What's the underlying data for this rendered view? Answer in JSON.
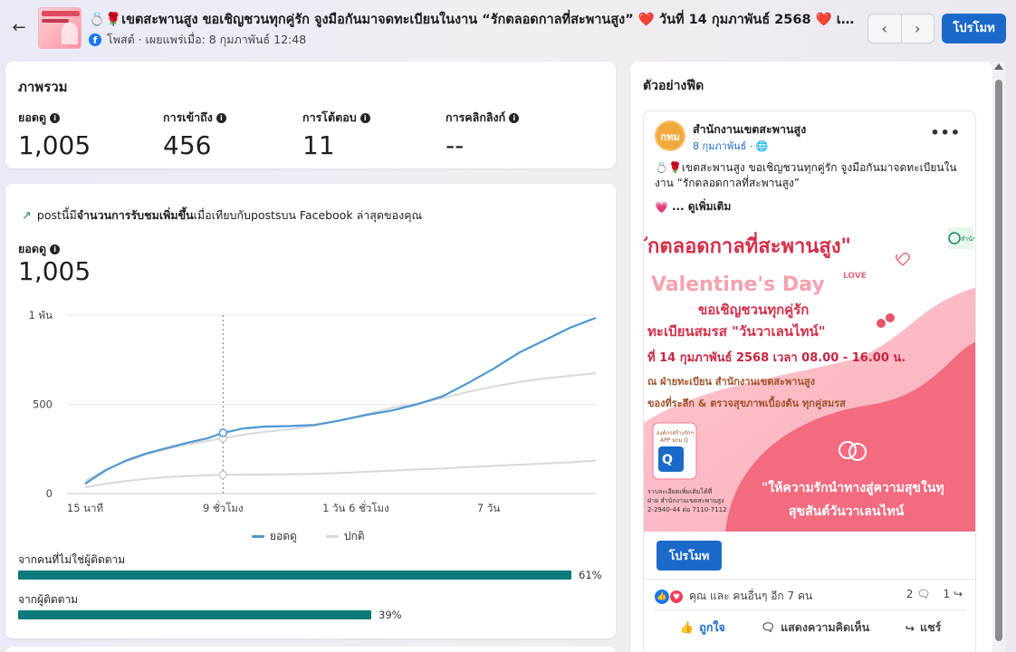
{
  "header": {
    "post_title": "💍🌹เขตสะพานสูง ขอเชิญชวนทุกคู่รัก จูงมือกันมาจดทะเบียนในงาน “รักตลอดกาลที่สะพานสูง” ❤️ วันที่ 14 กุมภาพันธ์ 2568 ❤️ เว...",
    "meta": "โพสต์ · เผยแพร่เมื่อ: 8 กุมภาพันธ์ 12:48",
    "promote_label": "โปรโมท",
    "prev_label": "‹",
    "next_label": "›"
  },
  "overview": {
    "title": "ภาพรวม",
    "metrics": [
      {
        "label": "ยอดดู",
        "value": "1,005"
      },
      {
        "label": "การเข้าถึง",
        "value": "456"
      },
      {
        "label": "การโต้ตอบ",
        "value": "11"
      },
      {
        "label": "การคลิกลิงก์",
        "value": "--"
      }
    ]
  },
  "views": {
    "trend_prefix": "postนี้มี",
    "trend_bold": "จำนวนการรับชมเพิ่มขึ้น",
    "trend_suffix": "เมื่อเทียบกับpostsบน Facebook ล่าสุดของคุณ",
    "label": "ยอดดู",
    "value": "1,005",
    "legend": [
      {
        "name": "ยอดดู",
        "color": "#4d97d1"
      },
      {
        "name": "ปกติ",
        "color": "#d6d8dc"
      }
    ],
    "breakdown": [
      {
        "label": "จากคนที่ไม่ใช่ผู้ติดตาม",
        "percent": 61,
        "percent_label": "61%"
      },
      {
        "label": "จากผู้ติดตาม",
        "percent": 39,
        "percent_label": "39%"
      }
    ]
  },
  "chart_data": {
    "type": "line",
    "y_ticks": [
      "0",
      "500",
      "1 พัน"
    ],
    "ylim": [
      0,
      1000
    ],
    "x_ticks": [
      "15 นาที",
      "9 ชั่วโมง",
      "1 วัน 6 ชั่วโมง",
      "7 วัน"
    ],
    "x_tick_positions": [
      0.0,
      0.27,
      0.53,
      0.79
    ],
    "hover_x": 0.27,
    "series": [
      {
        "name": "ยอดดู",
        "color": "#4d97d1",
        "x": [
          0.0,
          0.04,
          0.08,
          0.12,
          0.16,
          0.2,
          0.24,
          0.27,
          0.31,
          0.35,
          0.4,
          0.45,
          0.5,
          0.55,
          0.6,
          0.65,
          0.7,
          0.75,
          0.8,
          0.85,
          0.9,
          0.95,
          1.0
        ],
        "values": [
          55,
          130,
          185,
          225,
          255,
          285,
          310,
          340,
          365,
          375,
          378,
          385,
          410,
          440,
          465,
          500,
          545,
          620,
          700,
          790,
          860,
          930,
          985
        ]
      },
      {
        "name": "ปกติ",
        "color": "#d6d8dc",
        "x": [
          0.0,
          0.04,
          0.08,
          0.12,
          0.16,
          0.2,
          0.24,
          0.27,
          0.31,
          0.35,
          0.4,
          0.45,
          0.5,
          0.55,
          0.6,
          0.65,
          0.7,
          0.75,
          0.8,
          0.85,
          0.9,
          0.95,
          1.0
        ],
        "values": [
          70,
          135,
          180,
          220,
          250,
          275,
          295,
          310,
          330,
          345,
          360,
          380,
          410,
          445,
          480,
          505,
          535,
          570,
          600,
          625,
          645,
          660,
          675
        ]
      },
      {
        "name": "ปกติ-ต่ำ",
        "color": "#d6d8dc",
        "x": [
          0.0,
          0.04,
          0.08,
          0.12,
          0.16,
          0.2,
          0.24,
          0.27,
          0.31,
          0.35,
          0.4,
          0.45,
          0.5,
          0.55,
          0.6,
          0.65,
          0.7,
          0.75,
          0.8,
          0.85,
          0.9,
          0.95,
          1.0
        ],
        "values": [
          35,
          55,
          70,
          82,
          92,
          98,
          102,
          105,
          105,
          106,
          108,
          110,
          115,
          122,
          128,
          135,
          140,
          148,
          155,
          162,
          168,
          175,
          185
        ]
      }
    ]
  },
  "preview": {
    "title": "ตัวอย่างฟีด",
    "page_name": "สำนักงานเขตสะพานสูง",
    "avatar_text": "กทม",
    "date": "8 กุมภาพันธ์ · 🌐",
    "text": "💍🌹เขตสะพานสูง ขอเชิญชวนทุกคู่รัก จูงมือกันมาจดทะเบียนในงาน “รักตลอดกาลที่สะพานสูง”",
    "see_more": "... ดูเพิ่มเติม",
    "poster": {
      "line1": "ักตลอดกาลที่สะพานสูง\"",
      "line2": "Valentine's Day",
      "line3": "ขอเชิญชวนทุกคู่รัก",
      "line4": "ทะเบียนสมรส \"วันวาเลนไทน์\"",
      "line5": "ที่ 14 กุมภาพันธ์ 2568 เวลา 08.00 - 16.00 น.",
      "line6": "ณ ฝ่ายทะเบียน สำนักงานเขตสะพานสูง",
      "line7": "ของที่ระลึก & ตรวจสุขภาพเบื้องต้น ทุกคู่สมรส",
      "line8": "\"ให้ความรักนำทางสู่ความสุขในทุ",
      "line9": "สุขสันต์วันวาเลนไทน์",
      "love": "LOVE",
      "side_logo": "สำนัก",
      "contact1": "ราบละเอียดเพิ่มเติมได้ที่",
      "contact2": "ฝ่าย สำนักงานเขตสะพานสูง",
      "contact3": "2-2940-44 ต่อ 7110-7112",
      "qr_title": "องค์กรสร้างรักฯ",
      "qr_sub": "APP ยกม Q"
    },
    "promote_label": "โปรโมท",
    "reaction_text": "คุณ และ คนอื่นๆ อีก 7 คน",
    "comments_count": "2",
    "shares_count": "1",
    "actions": {
      "like": "ถูกใจ",
      "comment": "แสดงความคิดเห็น",
      "share": "แชร์"
    }
  }
}
